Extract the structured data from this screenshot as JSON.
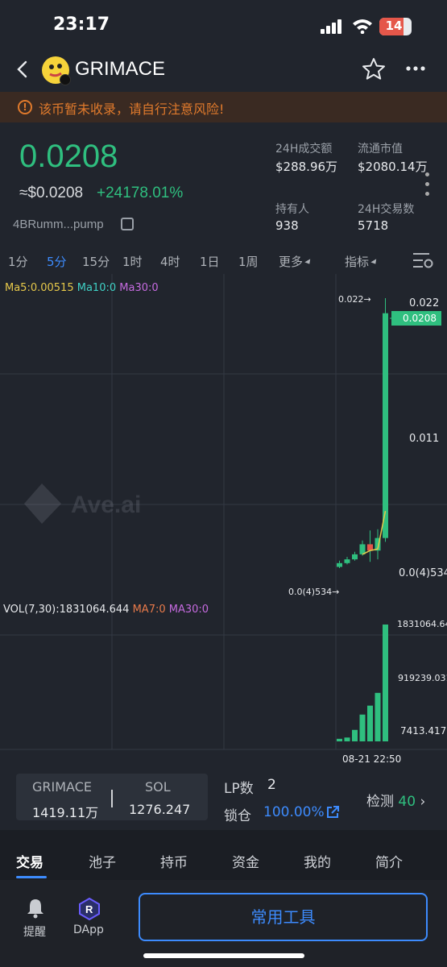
{
  "status": {
    "time": "23:17",
    "battery": "14"
  },
  "header": {
    "title": "GRIMACE"
  },
  "warning": {
    "text": "该币暂未收录，请自行注意风险!"
  },
  "price": {
    "main": "0.0208",
    "usd": "≈$0.0208",
    "change": "+24178.01%",
    "address": "4BRumm...pump"
  },
  "stats": {
    "vol_label": "24H成交额",
    "vol_value": "$288.96万",
    "mcap_label": "流通市值",
    "mcap_value": "$2080.14万",
    "holders_label": "持有人",
    "holders_value": "938",
    "txns_label": "24H交易数",
    "txns_value": "5718"
  },
  "timeframes": [
    "1分",
    "5分",
    "15分",
    "1时",
    "4时",
    "1日",
    "1周",
    "更多",
    "指标"
  ],
  "active_timeframe": "5分",
  "ma": {
    "ma5": "Ma5:0.00515",
    "ma10": "Ma10:0",
    "ma30": "Ma30:0"
  },
  "vol_legend": {
    "vol": "VOL(7,30):1831064.644",
    "ma7": "MA7:0",
    "ma30": "MA30:0"
  },
  "chart_data": {
    "type": "candlestick",
    "price_axis": [
      "0.022",
      "0.011",
      "0.0(4)534"
    ],
    "current_price_tag": "0.0208",
    "high_marker": "0.022→",
    "low_marker": "0.0(4)534→",
    "volume_axis": [
      "1831064.644",
      "919239.031",
      "7413.417"
    ],
    "x_label": "08-21 22:50",
    "watermark": "Ave.ai",
    "candles": [
      {
        "open": 0.0006,
        "close": 0.0009,
        "high": 0.0011,
        "low": 0.0005
      },
      {
        "open": 0.0009,
        "close": 0.0012,
        "high": 0.0014,
        "low": 0.0008
      },
      {
        "open": 0.0012,
        "close": 0.0016,
        "high": 0.0018,
        "low": 0.0011
      },
      {
        "open": 0.0016,
        "close": 0.0024,
        "high": 0.0027,
        "low": 0.0015
      },
      {
        "open": 0.0024,
        "close": 0.0019,
        "high": 0.0035,
        "low": 0.001
      },
      {
        "open": 0.0019,
        "close": 0.0029,
        "high": 0.0036,
        "low": 0.0012
      },
      {
        "open": 0.0029,
        "close": 0.0208,
        "high": 0.022,
        "low": 0.0026
      }
    ],
    "volumes": [
      40000,
      60000,
      180000,
      420000,
      560000,
      760000,
      1831064
    ]
  },
  "pair": {
    "base": "GRIMACE",
    "quote": "SOL",
    "base_amount": "1419.11万",
    "quote_amount": "1276.247"
  },
  "lp": {
    "label": "LP数",
    "value": "2",
    "lock_label": "锁仓",
    "lock_value": "100.00%"
  },
  "check": {
    "label": "检测",
    "value": "40"
  },
  "tabs": [
    "交易",
    "池子",
    "持币",
    "资金",
    "我的",
    "简介"
  ],
  "footer": {
    "alert": "提醒",
    "dapp": "DApp",
    "tools": "常用工具"
  },
  "colors": {
    "up": "#2fbf7f",
    "accent": "#3d8bfd",
    "warning": "#e07a2c"
  }
}
